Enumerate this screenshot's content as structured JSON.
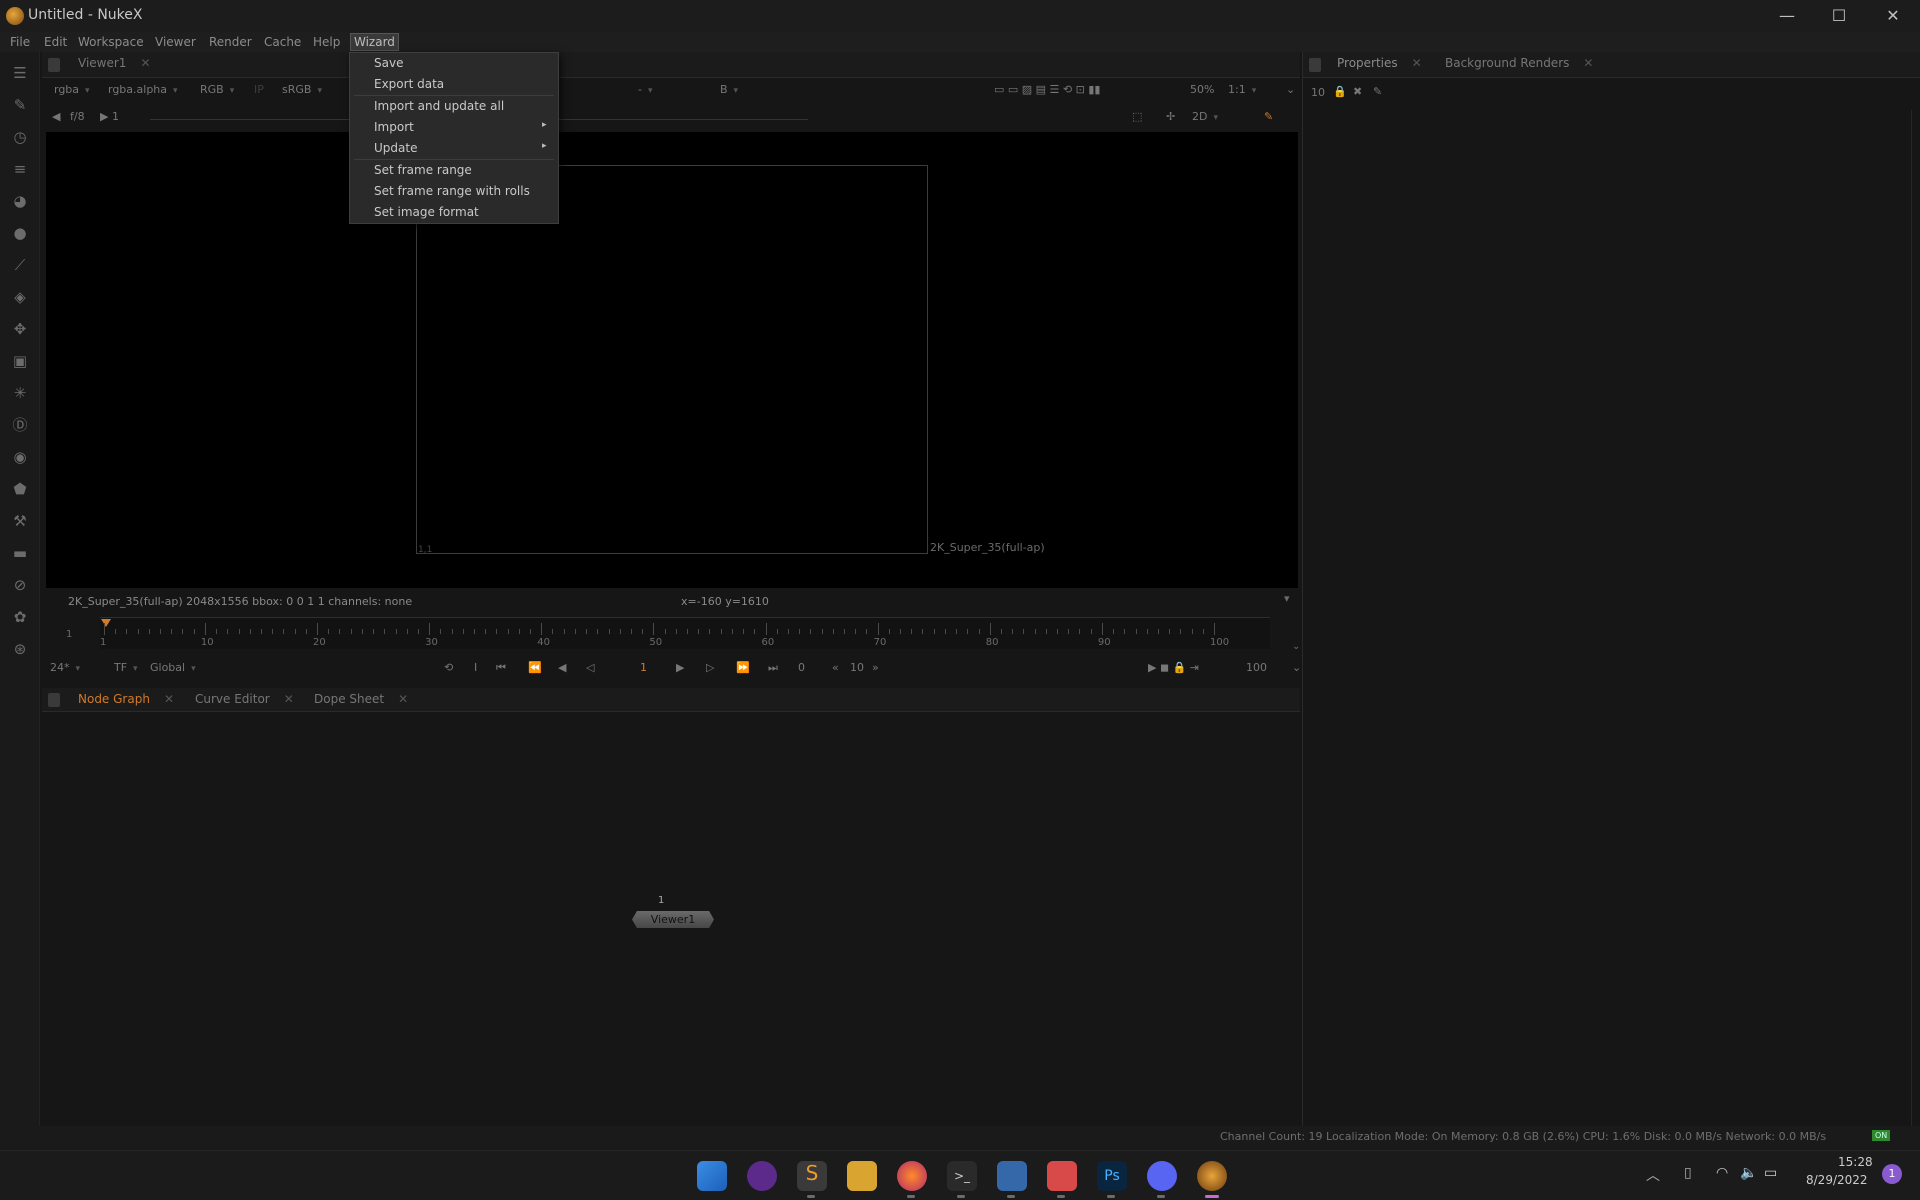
{
  "window": {
    "title": "Untitled - NukeX",
    "minimize": "—",
    "maximize": "☐",
    "close": "✕"
  },
  "menubar": [
    "File",
    "Edit",
    "Workspace",
    "Viewer",
    "Render",
    "Cache",
    "Help",
    "Wizard"
  ],
  "wizard_menu": {
    "items": [
      "Save",
      "Export data",
      "Import and update all",
      "Import",
      "Update",
      "Set frame range",
      "Set frame range with rolls",
      "Set image format"
    ],
    "submenu_arrow": "▸"
  },
  "viewer": {
    "tab_label": "Viewer1",
    "channels": "rgba",
    "alpha": "rgba.alpha",
    "rgb": "RGB",
    "colorspace": "sRGB",
    "b_input": "B",
    "dash": "-",
    "zoom": "50%",
    "ratio": "1:1",
    "fstop": "f/8",
    "frame_field": "1",
    "view_mode": "2D",
    "format_label": "2K_Super_35(full-ap)",
    "corner_label": "1,1",
    "info_left": "2K_Super_35(full-ap) 2048x1556  bbox: 0 0 1 1 channels: none",
    "coords": "x=-160 y=1610"
  },
  "timeline": {
    "start": "1",
    "end": "100",
    "end2": "100",
    "tick_labels": [
      "1",
      "10",
      "20",
      "30",
      "40",
      "50",
      "60",
      "70",
      "80",
      "90",
      "100"
    ],
    "fps": "24*",
    "tf": "TF",
    "range_mode": "Global",
    "current_frame": "1",
    "step": "10",
    "zero": "0"
  },
  "bottom_tabs": [
    "Node Graph",
    "Curve Editor",
    "Dope Sheet"
  ],
  "node": {
    "label": "Viewer1",
    "input_number": "1"
  },
  "properties": {
    "tabs": [
      "Properties",
      "Background Renders"
    ],
    "max_panels": "10"
  },
  "status": "Channel Count: 19  Localization Mode: On  Memory: 0.8 GB (2.6%)  CPU: 1.6%  Disk: 0.0 MB/s  Network: 0.0 MB/s",
  "status_badge": "ON",
  "taskbar": {
    "time": "15:28",
    "date": "8/29/2022",
    "notification_count": "1"
  },
  "colors": {
    "accent_orange": "#d07a2a",
    "menu_bg": "#2a2a2a",
    "viewport_bg": "#000000"
  }
}
